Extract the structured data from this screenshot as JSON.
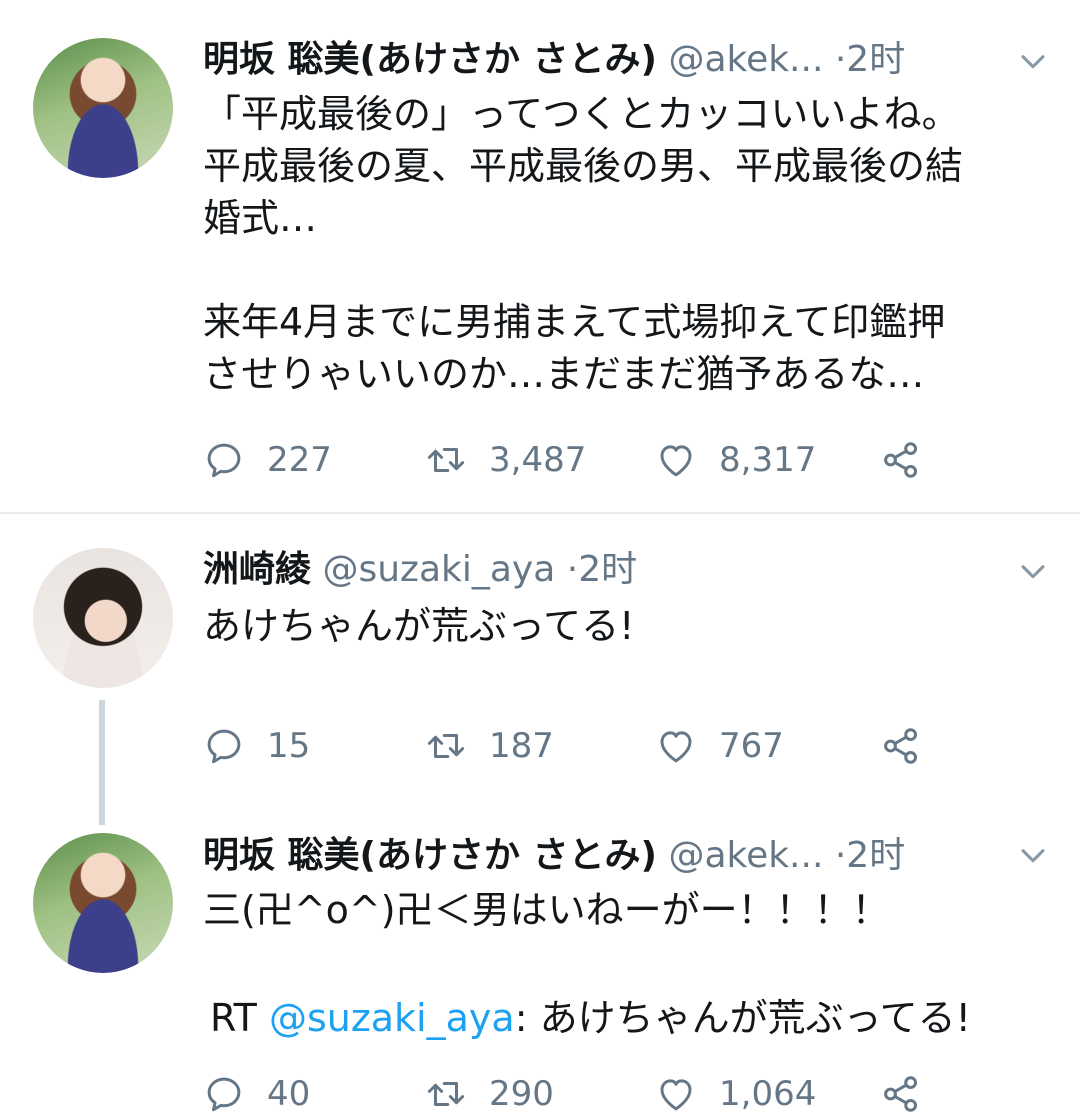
{
  "tweets": [
    {
      "name": "明坂 聡美(あけさか さとみ)",
      "handle": "@akek...",
      "dot": "·",
      "time": "2时",
      "body": "「平成最後の」ってつくとカッコいいよね。\n平成最後の夏、平成最後の男、平成最後の結\n婚式…\n\n来年4月までに男捕まえて式場抑えて印鑑押\nさせりゃいいのか…まだまだ猶予あるな…",
      "replies": "227",
      "retweets": "3,487",
      "likes": "8,317"
    },
    {
      "name": "洲崎綾",
      "handle": "@suzaki_aya",
      "dot": "·",
      "time": "2时",
      "body": "あけちゃんが荒ぶってる!",
      "replies": "15",
      "retweets": "187",
      "likes": "767"
    },
    {
      "name": "明坂 聡美(あけさか さとみ)",
      "handle": "@akek...",
      "dot": "·",
      "time": "2时",
      "body": "三(卍^o^)卍＜男はいねーがー！！！！",
      "rt_prefix": "RT ",
      "rt_mention": "@suzaki_aya",
      "rt_text": ": あけちゃんが荒ぶってる!",
      "replies": "40",
      "retweets": "290",
      "likes": "1,064"
    }
  ],
  "icons": {
    "reply": "reply-icon",
    "retweet": "retweet-icon",
    "like": "heart-icon",
    "share": "share-icon",
    "caret": "chevron-down-icon"
  },
  "colors": {
    "link": "#1da1f2",
    "muted": "#657786",
    "text": "#14171a"
  }
}
